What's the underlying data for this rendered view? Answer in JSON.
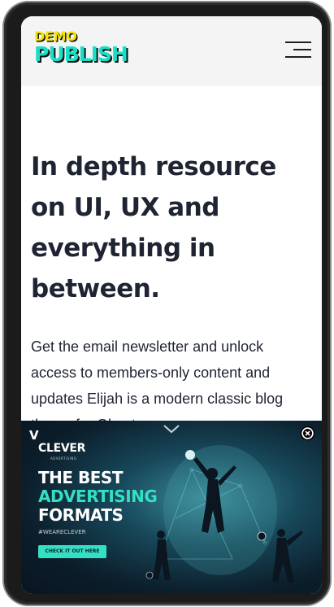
{
  "header": {
    "logo_top": "DEMO",
    "logo_bottom": "PUBLISH",
    "menu_icon": "hamburger-menu-icon"
  },
  "hero": {
    "title_lines": [
      "In depth resource",
      "on UI, UX and",
      "everything in",
      "between."
    ],
    "text_lines": [
      "Get the email newsletter and unlock",
      "access to members-only content and",
      "updates Elijah is a modern classic blog",
      "theme for Ghost."
    ]
  },
  "ad": {
    "logo_letter": "V",
    "brand": "CLEVER",
    "brand_sub": "ADVERTISING",
    "headline_1": "THE BEST",
    "headline_2": "ADVERTISING",
    "headline_3": "FORMATS",
    "hashtag": "#WEARECLEVER",
    "cta_label": "CHECK IT OUT HERE",
    "collapse_icon": "chevron-down-icon",
    "close_icon": "close-circle-icon",
    "accent_color": "#34e0c3"
  },
  "colors": {
    "logo_yellow": "#f3e600",
    "logo_teal": "#18e0c8",
    "text_dark": "#1f2433",
    "header_bg": "#f4f4f4"
  }
}
